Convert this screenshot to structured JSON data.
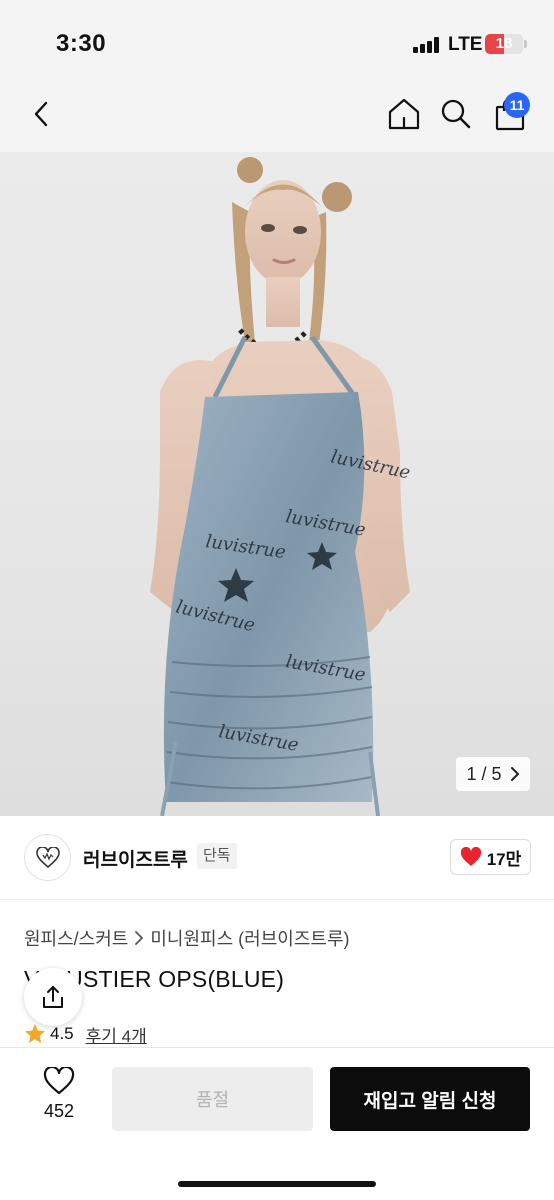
{
  "status_bar": {
    "time": "3:30",
    "network": "LTE",
    "battery": "18",
    "battery_level_percent": 18,
    "battery_color": "#e8454a"
  },
  "nav": {
    "back_icon": "chevron-left-icon",
    "home_icon": "home-icon",
    "search_icon": "search-icon",
    "cart_icon": "shopping-bag-icon",
    "cart_count": "11",
    "badge_color": "#2b66f6"
  },
  "gallery": {
    "counter": "1 / 5"
  },
  "brand": {
    "name": "러브이즈트루",
    "exclusive_badge": "단독",
    "likes": "17만"
  },
  "breadcrumb": {
    "items": [
      "원피스/스커트",
      "미니원피스 (러브이즈트루)"
    ]
  },
  "product": {
    "title": "V. BUSTIER OPS(BLUE)",
    "rating": "4.5",
    "reviews": "후기 4개"
  },
  "bottom_bar": {
    "wish_count": "452",
    "soldout_label": "품절",
    "restock_label": "재입고 알림 신청"
  }
}
